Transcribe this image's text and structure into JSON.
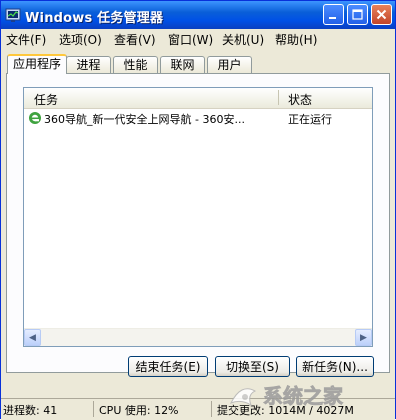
{
  "window": {
    "title": "Windows 任务管理器"
  },
  "title_buttons": [
    "minimize-icon",
    "maximize-icon",
    "close-icon"
  ],
  "menu": [
    {
      "label": "文件(F)"
    },
    {
      "label": "选项(O)"
    },
    {
      "label": "查看(V)"
    },
    {
      "label": "窗口(W)"
    },
    {
      "label": "关机(U)"
    },
    {
      "label": "帮助(H)"
    }
  ],
  "tabs": [
    {
      "label": "应用程序",
      "active": true
    },
    {
      "label": "进程"
    },
    {
      "label": "性能"
    },
    {
      "label": "联网"
    },
    {
      "label": "用户"
    }
  ],
  "list": {
    "columns": [
      "任务",
      "状态"
    ],
    "rows": [
      {
        "icon": "ie-browser-icon",
        "task": "360导航_新一代安全上网导航 - 360安...",
        "status": "正在运行"
      }
    ]
  },
  "buttons": {
    "end_task": "结束任务(E)",
    "switch_to": "切换至(S)",
    "new_task": "新任务(N)..."
  },
  "statusbar": {
    "processes": "进程数: 41",
    "cpu": "CPU 使用: 12%",
    "commit": "提交更改: 1014M / 4027M"
  },
  "watermark": {
    "text": "系统之家"
  },
  "colors": {
    "title_bar": "#0a5fd8",
    "window_bg": "#ece9d8",
    "active_tab_highlight": "#ffc83c"
  }
}
